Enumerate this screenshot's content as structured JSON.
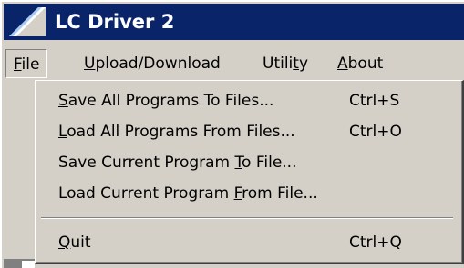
{
  "window": {
    "title": "LC Driver 2"
  },
  "menubar": {
    "items": [
      {
        "label_pre": "",
        "label_ul": "F",
        "label_post": "ile"
      },
      {
        "label_pre": "",
        "label_ul": "U",
        "label_post": "pload/Download"
      },
      {
        "label_pre": "Utili",
        "label_ul": "t",
        "label_post": "y"
      },
      {
        "label_pre": "",
        "label_ul": "A",
        "label_post": "bout"
      }
    ]
  },
  "file_menu": {
    "items": [
      {
        "pre": "",
        "ul": "S",
        "post": "ave All Programs To Files...",
        "shortcut": "Ctrl+S"
      },
      {
        "pre": "",
        "ul": "L",
        "post": "oad All Programs From Files...",
        "shortcut": "Ctrl+O"
      },
      {
        "pre": "Save Current Program ",
        "ul": "T",
        "post": "o File...",
        "shortcut": ""
      },
      {
        "pre": "Load Current Program ",
        "ul": "F",
        "post": "rom File...",
        "shortcut": ""
      },
      {
        "pre": "",
        "ul": "Q",
        "post": "uit",
        "shortcut": "Ctrl+Q"
      }
    ]
  },
  "colors": {
    "titlebar": "#0a246a",
    "face": "#d4d0c8",
    "shadow": "#808080",
    "highlight": "#ffffff"
  }
}
